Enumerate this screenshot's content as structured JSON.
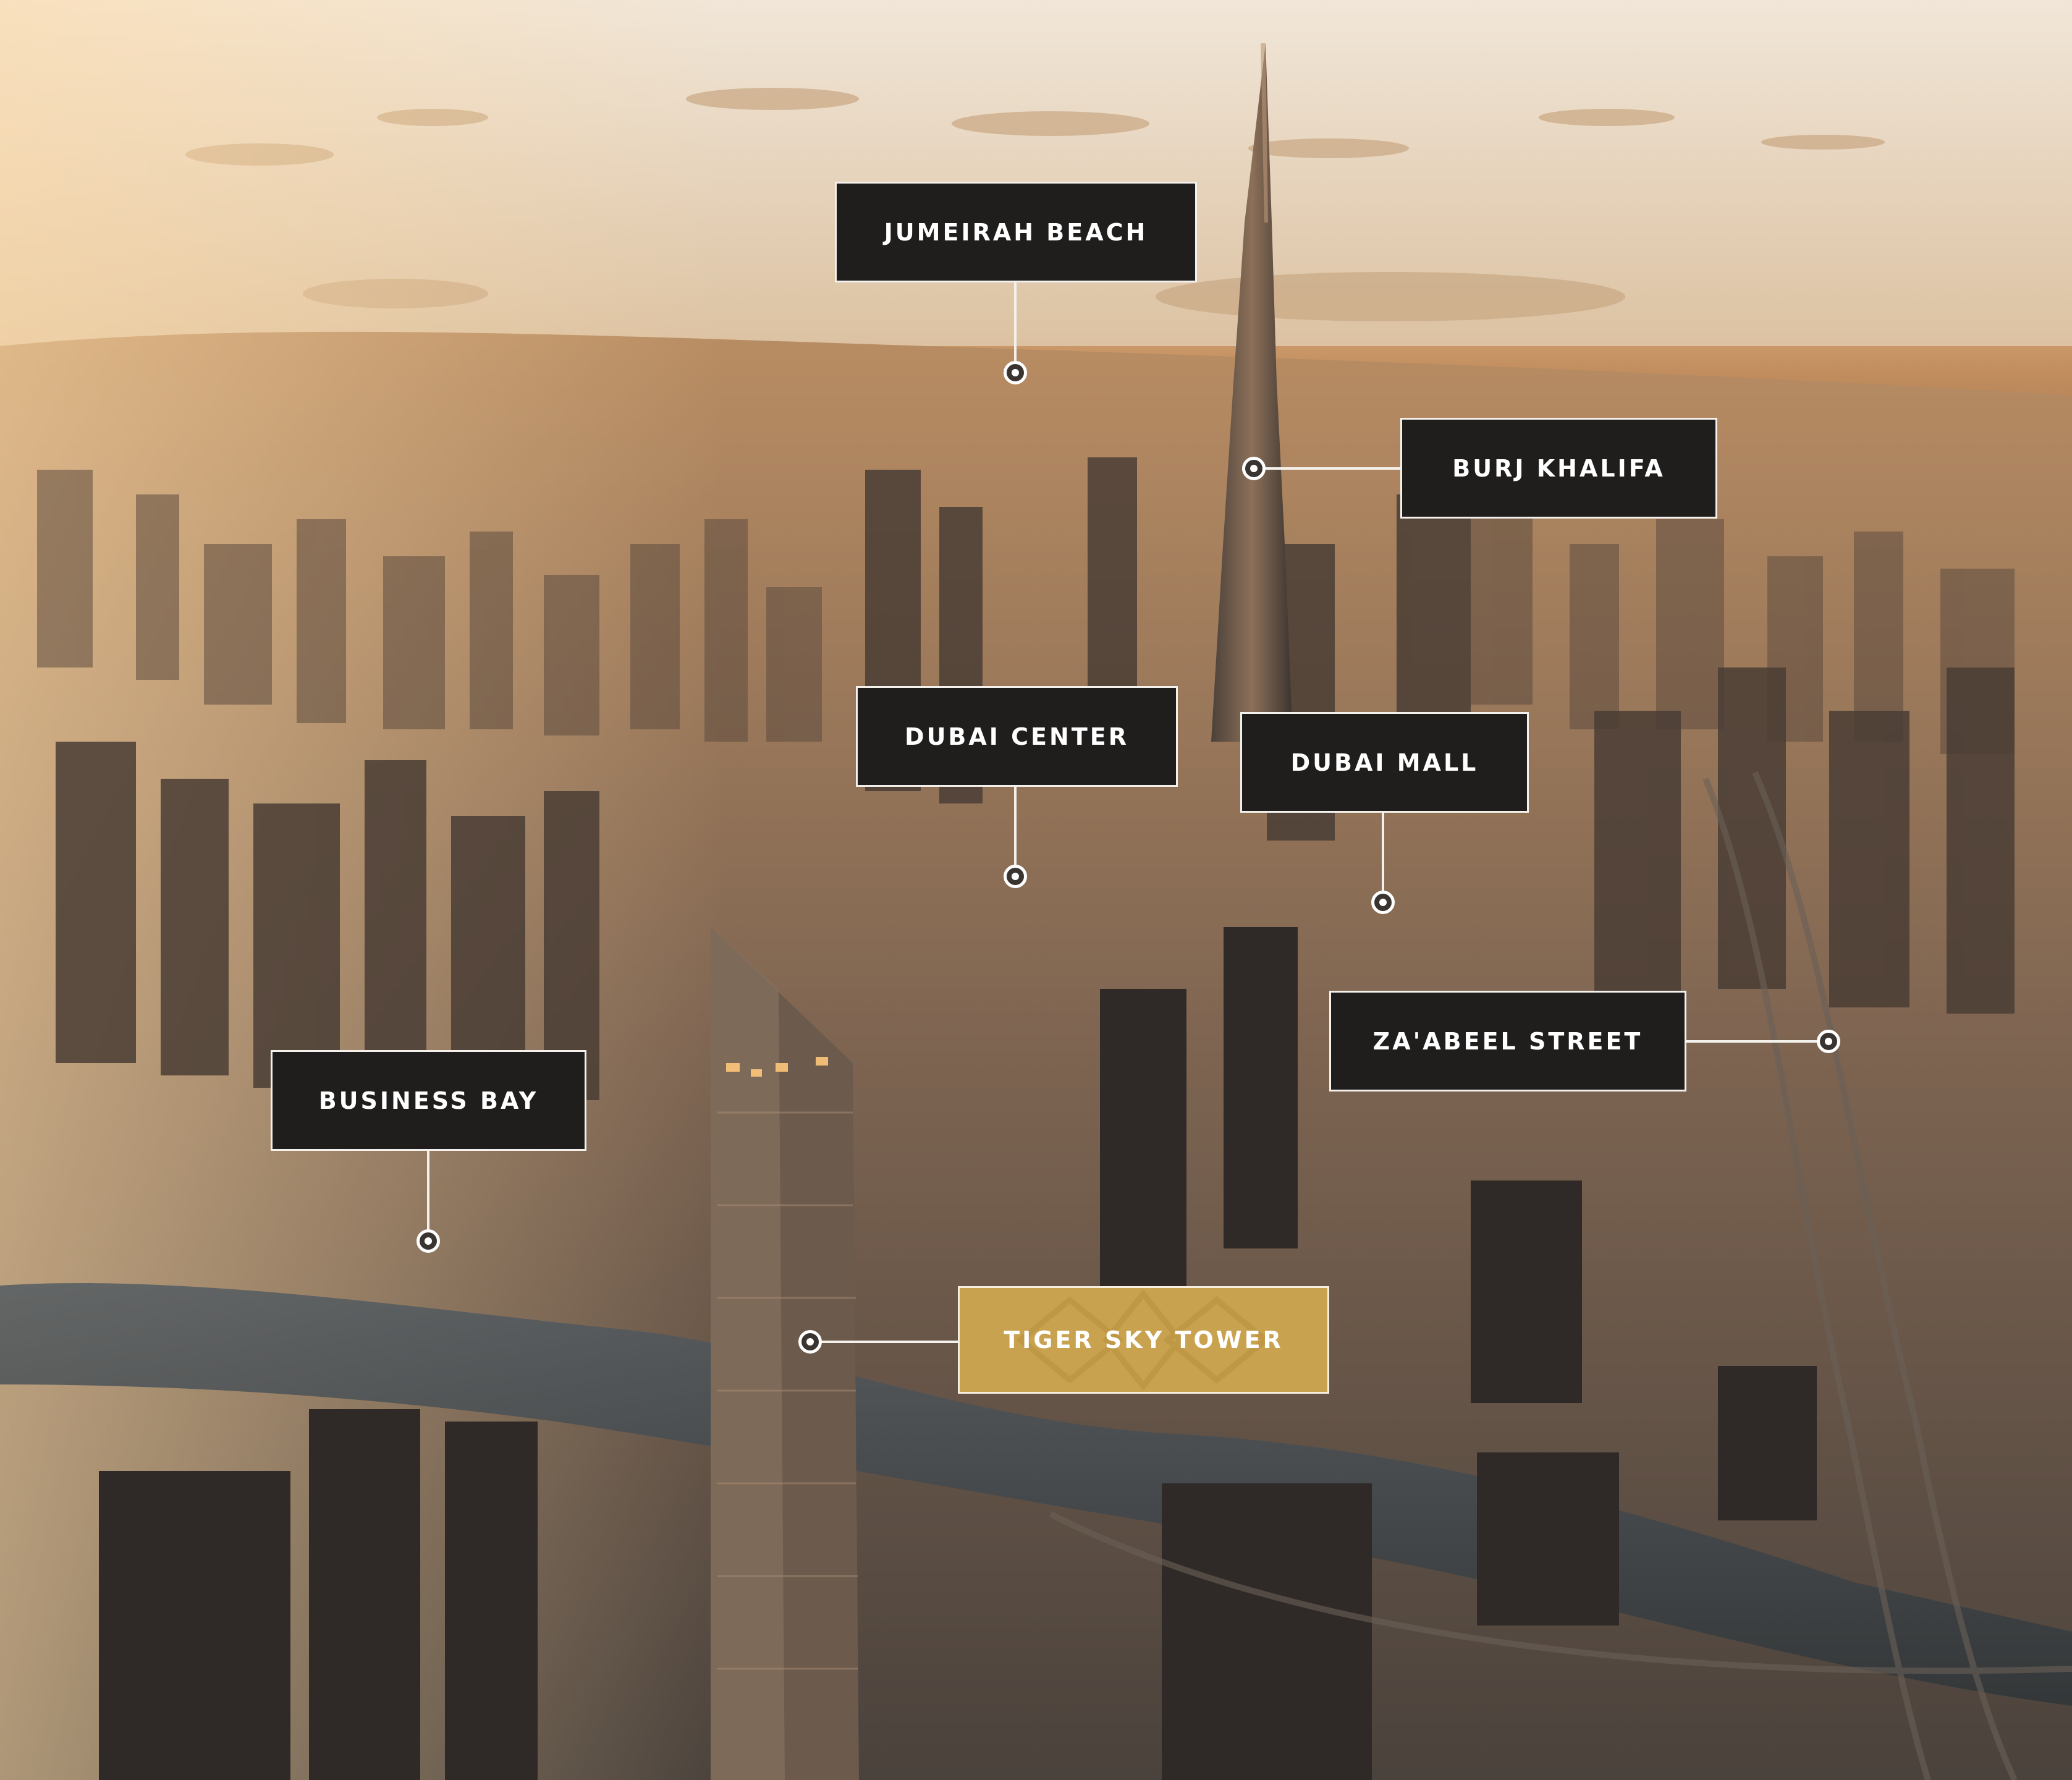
{
  "scene": "aerial view of Dubai at sunset",
  "colors": {
    "label_background": "#1f1e1d",
    "label_border": "#f4f1ec",
    "label_text": "#ffffff",
    "featured_background": "#c9a24f"
  },
  "labels": {
    "jumeirah_beach": "JUMEIRAH BEACH",
    "burj_khalifa": "BURJ KHALIFA",
    "dubai_center": "DUBAI CENTER",
    "dubai_mall": "DUBAI MALL",
    "zaabeel_street": "ZA'ABEEL STREET",
    "business_bay": "BUSINESS BAY",
    "tiger_sky_tower": "TIGER SKY TOWER"
  },
  "icons": {
    "location_pin": "location-pin-icon"
  }
}
